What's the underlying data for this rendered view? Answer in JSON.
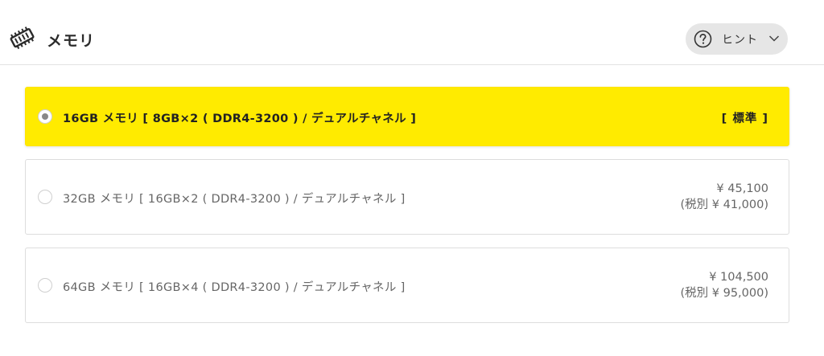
{
  "section": {
    "title": "メモリ",
    "icon": "memory-chip-icon"
  },
  "hint": {
    "label": "ヒント",
    "icon": "question-circle-icon",
    "chevron_icon": "chevron-down-icon"
  },
  "options": [
    {
      "label": "16GB メモリ [ 8GB×2 ( DDR4-3200 ) / デュアルチャネル ]",
      "badge": "[ 標準 ]",
      "selected": true
    },
    {
      "label": "32GB メモリ [ 16GB×2 ( DDR4-3200 ) / デュアルチャネル ]",
      "price": "¥ 45,100",
      "price_ex_tax": "(税別 ¥ 41,000)",
      "selected": false
    },
    {
      "label": "64GB メモリ [ 16GB×4 ( DDR4-3200 ) / デュアルチャネル ]",
      "price": "¥ 104,500",
      "price_ex_tax": "(税別 ¥ 95,000)",
      "selected": false
    }
  ],
  "colors": {
    "selected_background": "#ffeb00",
    "border": "#dddddd",
    "hint_background": "#e6e6e6"
  }
}
